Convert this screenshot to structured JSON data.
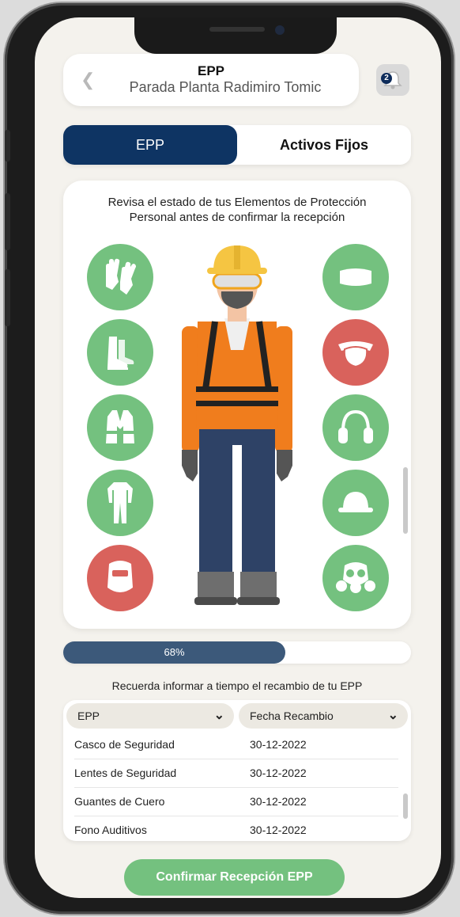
{
  "header": {
    "title": "EPP",
    "subtitle": "Parada Planta Radimiro Tomic",
    "notification_count": "2"
  },
  "tabs": [
    {
      "label": "EPP",
      "active": true
    },
    {
      "label": "Activos Fijos",
      "active": false
    }
  ],
  "card": {
    "instruction_line1": "Revisa el estado de tus Elementos de Protección",
    "instruction_line2": "Personal antes de confirmar la recepción",
    "left_items": [
      {
        "icon": "gloves-icon",
        "status": "ok"
      },
      {
        "icon": "boots-icon",
        "status": "ok"
      },
      {
        "icon": "vest-icon",
        "status": "ok"
      },
      {
        "icon": "coverall-icon",
        "status": "ok"
      },
      {
        "icon": "welding-mask-icon",
        "status": "alert"
      }
    ],
    "right_items": [
      {
        "icon": "goggles-icon",
        "status": "ok"
      },
      {
        "icon": "respirator-mask-icon",
        "status": "alert"
      },
      {
        "icon": "ear-muffs-icon",
        "status": "ok"
      },
      {
        "icon": "hard-hat-icon",
        "status": "ok"
      },
      {
        "icon": "gas-mask-icon",
        "status": "ok"
      }
    ]
  },
  "progress": {
    "label": "68%",
    "value": 0.68
  },
  "reminder": "Recuerda informar a tiempo el recambio de tu EPP",
  "table": {
    "columns": [
      "EPP",
      "Fecha Recambio"
    ],
    "rows": [
      [
        "Casco de Seguridad",
        "30-12-2022"
      ],
      [
        "Lentes de Seguridad",
        "30-12-2022"
      ],
      [
        "Guantes de Cuero",
        "30-12-2022"
      ],
      [
        "Fono Auditivos",
        "30-12-2022"
      ]
    ]
  },
  "confirm_button": "Confirmar Recepción EPP",
  "colors": {
    "primary": "#0e3463",
    "ok": "#74c17f",
    "alert": "#d9625c",
    "progress": "#3c597a"
  }
}
